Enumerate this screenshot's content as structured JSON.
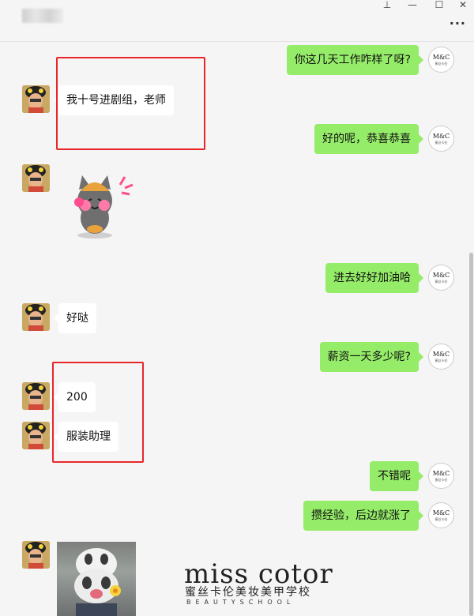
{
  "window": {
    "pin_glyph": "⊥",
    "minimize_glyph": "—",
    "maximize_glyph": "☐",
    "close_glyph": "✕",
    "more_glyph": "···"
  },
  "self_avatar": {
    "logo_text": "M&C",
    "logo_subtext": "蜜丝卡伦"
  },
  "messages": [
    {
      "side": "right",
      "text": "你这几天工作咋样了呀?"
    },
    {
      "side": "left",
      "text": "我十号进剧组，老师"
    },
    {
      "side": "right",
      "text": "好的呢，恭喜恭喜"
    },
    {
      "side": "left",
      "type": "sticker",
      "icon": "cat-sticker"
    },
    {
      "side": "right",
      "text": "进去好好加油哈"
    },
    {
      "side": "left",
      "text": "好哒"
    },
    {
      "side": "right",
      "text": "薪资一天多少呢?"
    },
    {
      "side": "left",
      "text": "200"
    },
    {
      "side": "left",
      "text": "服装助理"
    },
    {
      "side": "right",
      "text": "不错呢"
    },
    {
      "side": "right",
      "text": "攒经验，后边就涨了"
    },
    {
      "side": "left",
      "type": "image",
      "icon": "dog-photo"
    }
  ],
  "watermark": {
    "title": "miss cotor",
    "subtitle_cn": "蜜丝卡伦美妆美甲学校",
    "subtitle_en": "BEAUTYSCHOOL"
  },
  "colors": {
    "self_bubble": "#95ec69",
    "other_bubble": "#ffffff",
    "highlight_box": "#e8262a",
    "background": "#f5f5f5"
  }
}
